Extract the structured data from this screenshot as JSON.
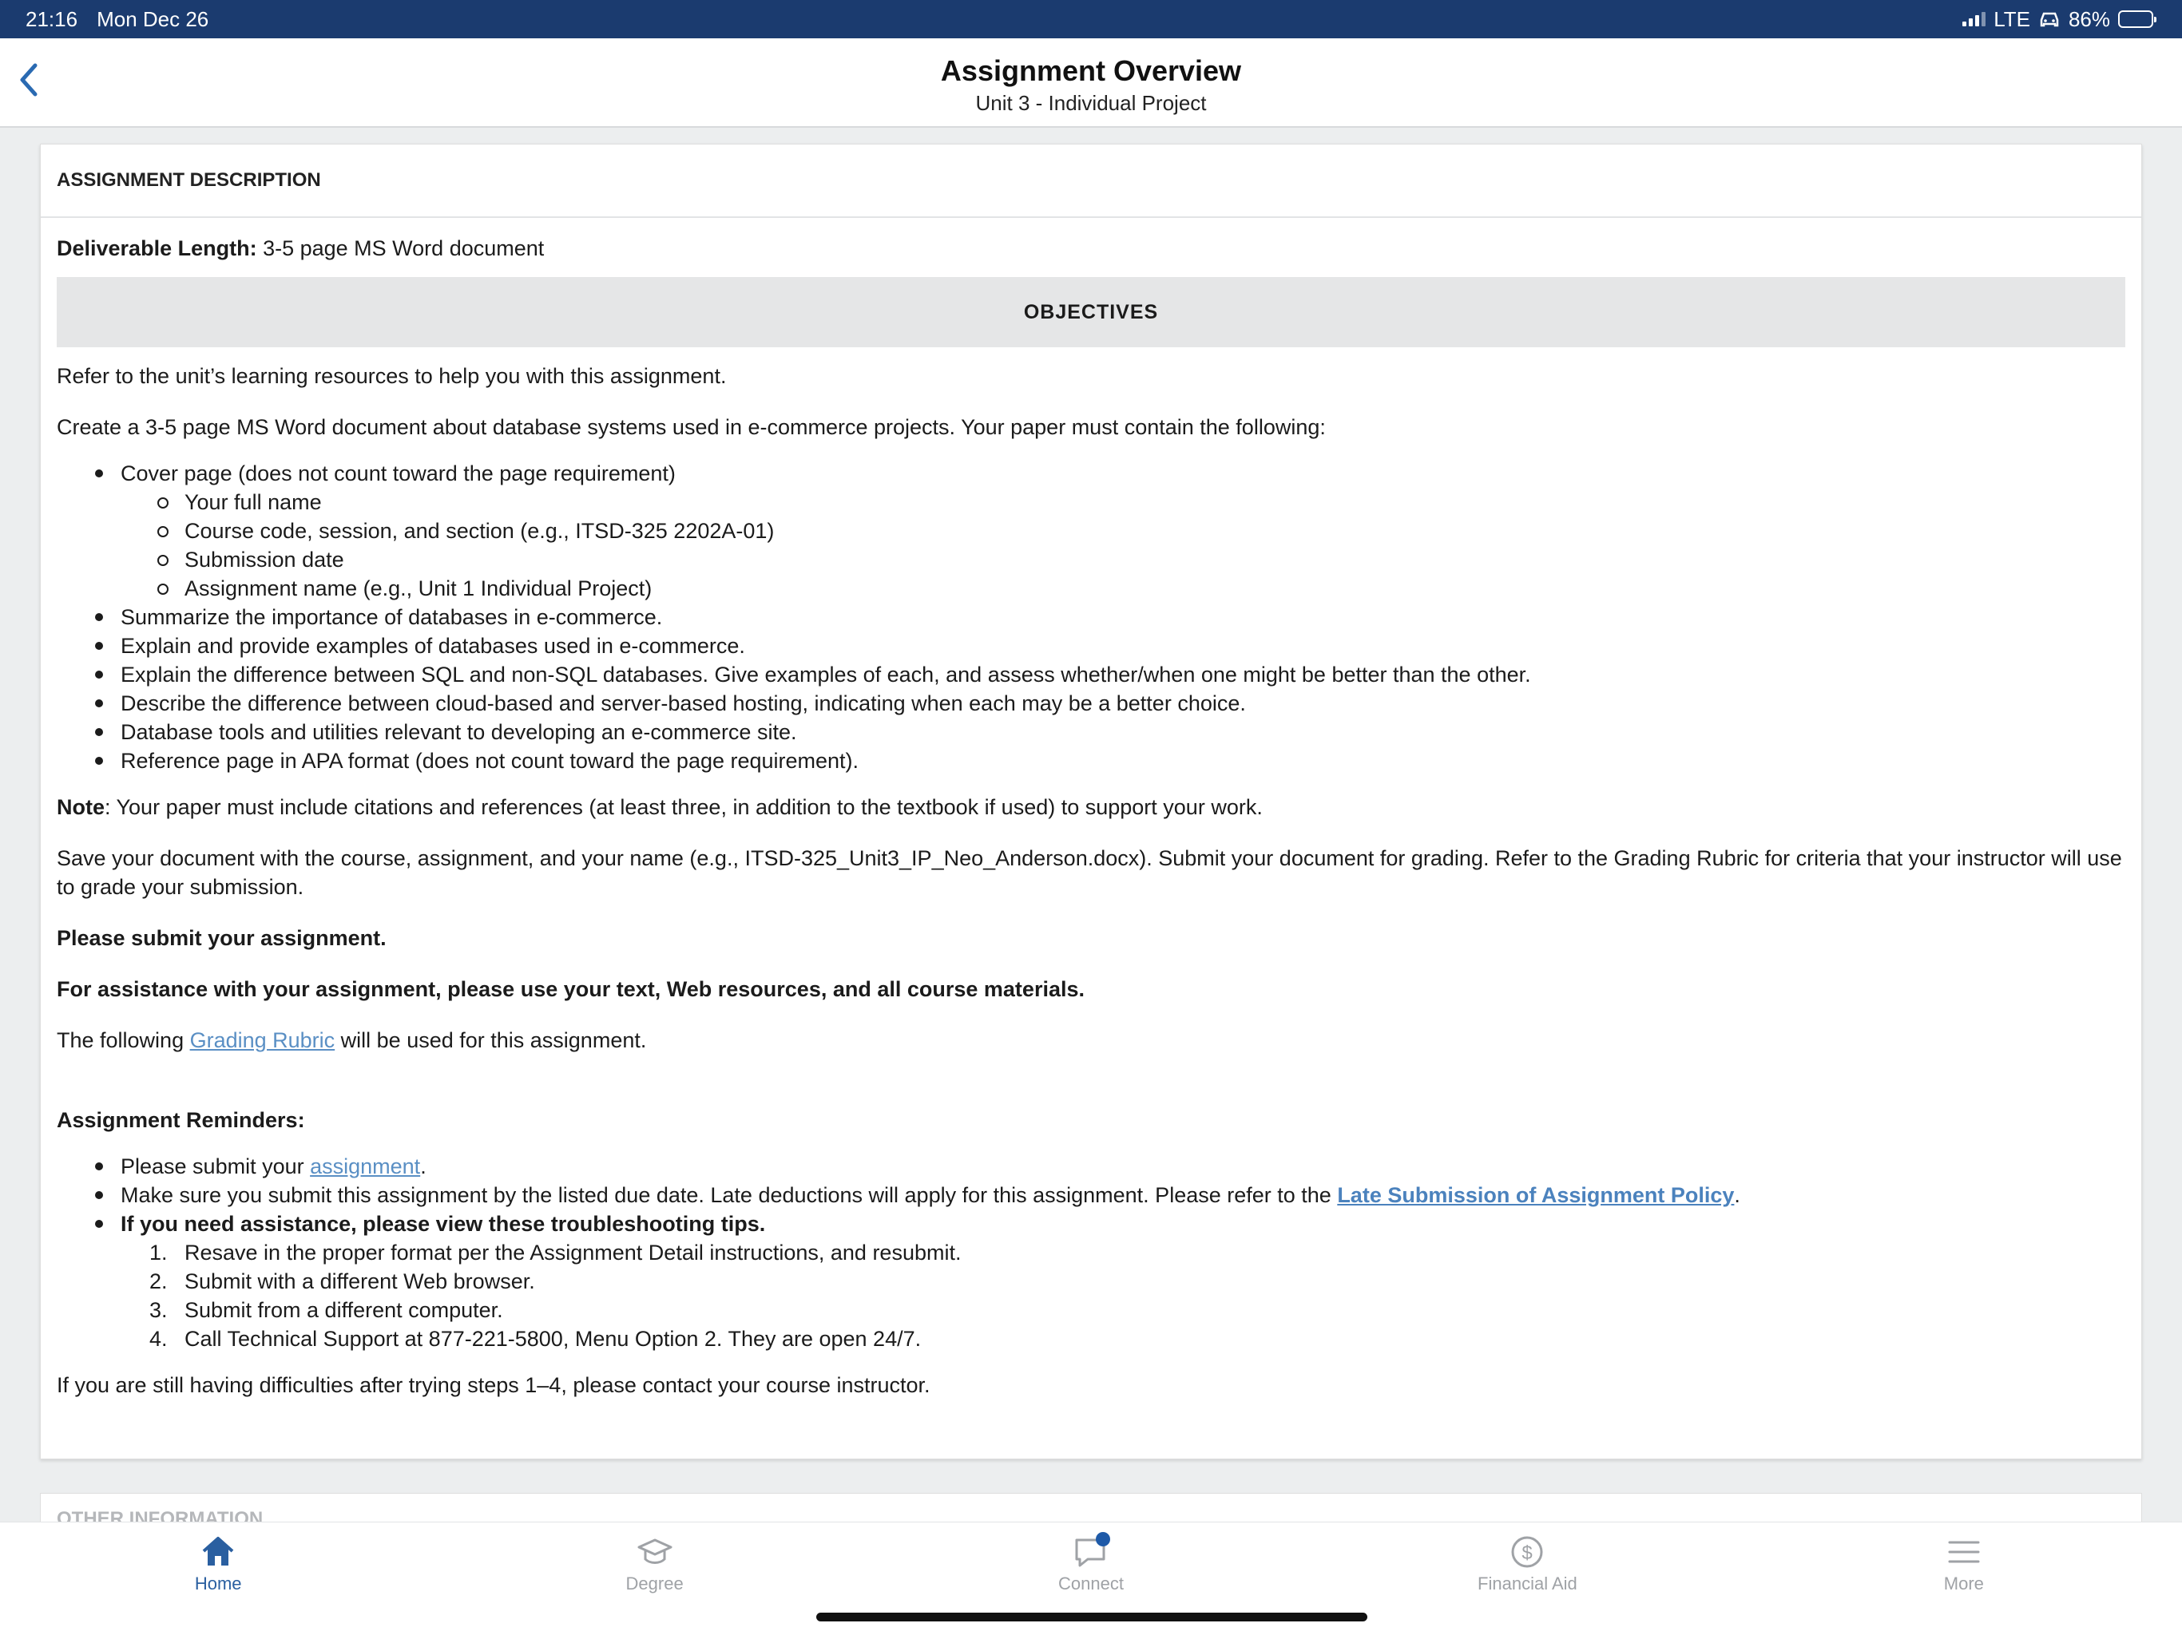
{
  "status_bar": {
    "time": "21:16",
    "date": "Mon Dec 26",
    "network": "LTE",
    "battery": "86%",
    "battery_level": 0.86
  },
  "header": {
    "title": "Assignment Overview",
    "subtitle": "Unit 3 - Individual Project",
    "back_icon": "chevron-left-icon"
  },
  "card": {
    "section_title": "ASSIGNMENT DESCRIPTION",
    "deliverable_label": "Deliverable Length:",
    "deliverable_value": "3-5 page MS Word document",
    "objectives_heading": "OBJECTIVES",
    "intro": "Refer to the unit’s learning resources to help you with this assignment.",
    "task": "Create a 3-5 page MS Word document about database systems used in e-commerce projects. Your paper must contain the following:",
    "requirements": {
      "cover_page": "Cover page (does not count toward the page requirement)",
      "cover_sub": [
        "Your full name",
        "Course code, session, and section (e.g., ITSD-325 2202A-01)",
        "Submission date",
        "Assignment name (e.g., Unit 1 Individual Project)"
      ],
      "items": [
        "Summarize the importance of databases in e-commerce.",
        "Explain and provide examples of databases used in e-commerce.",
        "Explain the difference between SQL and non-SQL databases. Give examples of each, and assess whether/when one might be better than the other.",
        "Describe the difference between cloud-based and server-based hosting, indicating when each may be a better choice.",
        "Database tools and utilities relevant to developing an e-commerce site.",
        "Reference page in APA format (does not count toward the page requirement)."
      ]
    },
    "note_label": "Note",
    "note_text": ": Your paper must include citations and references (at least three, in addition to the textbook if used) to support your work.",
    "save_text": "Save your document with the course, assignment, and your name (e.g., ITSD-325_Unit3_IP_Neo_Anderson.docx). Submit your document for grading. Refer to the Grading Rubric for criteria that your instructor will use to grade your submission.",
    "submit_text": "Please submit your assignment.",
    "assistance_text": "For assistance with your assignment, please use your text, Web resources, and all course materials.",
    "rubric_prefix": "The following ",
    "rubric_link": "Grading Rubric",
    "rubric_suffix": " will be used for this assignment.",
    "reminders_heading": "Assignment Reminders:",
    "reminder_submit_prefix": "Please submit your ",
    "reminder_submit_link": "assignment",
    "reminder_submit_suffix": ".",
    "reminder_due_prefix": "Make sure you submit this assignment by the listed due date. Late deductions will apply for this assignment. Please refer to the ",
    "reminder_due_link": "Late Submission of Assignment Policy",
    "reminder_due_suffix": ".",
    "reminder_help": "If you need assistance, please view these troubleshooting tips.",
    "troubleshooting": [
      {
        "num": "1.",
        "text": "Resave in the proper format per the Assignment Detail instructions, and resubmit."
      },
      {
        "num": "2.",
        "text": "Submit with a different Web browser."
      },
      {
        "num": "3.",
        "text": "Submit from a different computer."
      },
      {
        "num": "4.",
        "text": "Call Technical Support at 877-221-5800, Menu Option 2. They are open 24/7."
      }
    ],
    "closing": "If you are still having difficulties after trying steps 1–4, please contact your course instructor."
  },
  "card2": {
    "section_title": "OTHER INFORMATION"
  },
  "tab_bar": {
    "tabs": [
      {
        "label": "Home",
        "icon": "home-icon",
        "active": true
      },
      {
        "label": "Degree",
        "icon": "graduation-cap-icon",
        "active": false
      },
      {
        "label": "Connect",
        "icon": "chat-bubble-icon",
        "active": false
      },
      {
        "label": "Financial Aid",
        "icon": "dollar-icon",
        "active": false
      },
      {
        "label": "More",
        "icon": "menu-icon",
        "active": false
      }
    ],
    "accent": "#2a5fa0",
    "inactive": "#9fa2a6",
    "badge_color": "#1e5aa8"
  },
  "colors": {
    "status_bar": "#1b3b6f",
    "link": "#5a8fc4",
    "background": "#eceeef"
  }
}
